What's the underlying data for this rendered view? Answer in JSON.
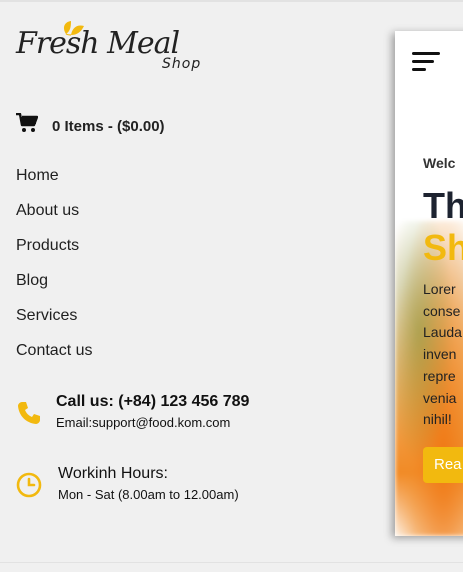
{
  "logo": {
    "brand": "Fresh Meal",
    "sub": "Shop"
  },
  "cart": {
    "label": "0 Items - ($0.00)",
    "icon": "cart-icon"
  },
  "nav": {
    "items": [
      "Home",
      "About us",
      "Products",
      "Blog",
      "Services",
      "Contact us"
    ]
  },
  "contact": {
    "call_title": "Call us: (+84) 123 456 789",
    "email": "Email:support@food.kom.com",
    "hours_title": "Workinh Hours:",
    "hours_value": "Mon - Sat (8.00am to 12.00am)"
  },
  "hero": {
    "welcome": "Welc",
    "title_line1": "Th",
    "title_line2": "Sh",
    "lorem": [
      "Lorer",
      "conse",
      "Lauda",
      "inven",
      "repre",
      "venia",
      "nihil!"
    ],
    "button": "Rea"
  },
  "colors": {
    "accent": "#f2b90f",
    "text": "#1f1f1f",
    "panel_bg": "#ffffff"
  }
}
